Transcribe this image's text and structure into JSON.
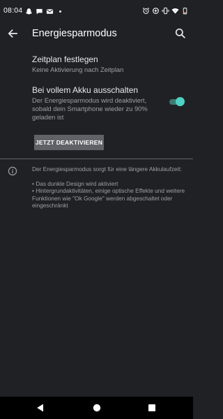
{
  "status_bar": {
    "time": "08:04",
    "left_icons": [
      "snapchat-icon",
      "chat-icon",
      "gmail-icon",
      "notification-dot-icon"
    ],
    "right_icons": [
      "alarm-icon",
      "data-saver-icon",
      "vibrate-icon",
      "wifi-icon",
      "battery-low-icon"
    ]
  },
  "toolbar": {
    "title": "Energiesparmodus"
  },
  "schedule": {
    "title": "Zeitplan festlegen",
    "summary": "Keine Aktivierung nach Zeitplan"
  },
  "full_battery": {
    "title": "Bei vollem Akku ausschalten",
    "summary": "Der Energiesparmodus wird deaktiviert, sobald dein Smartphone wieder zu 90% geladen ist",
    "toggle_on": true
  },
  "deactivate_button": {
    "label": "JETZT DEAKTIVIEREN"
  },
  "info": {
    "intro": "Der Energiesparmodus sorgt für eine längere Akkulaufzeit:",
    "bullet1": "• Das dunkle Design wird aktiviert",
    "bullet2": "• Hintergrundaktivitäten, einige optische Effekte und weitere Funktionen wie \"Ok Google\" werden abgeschaltet oder eingeschränkt"
  },
  "colors": {
    "background": "#202124",
    "accent": "#4fd1c5",
    "secondary_text": "#9aa0a6"
  }
}
